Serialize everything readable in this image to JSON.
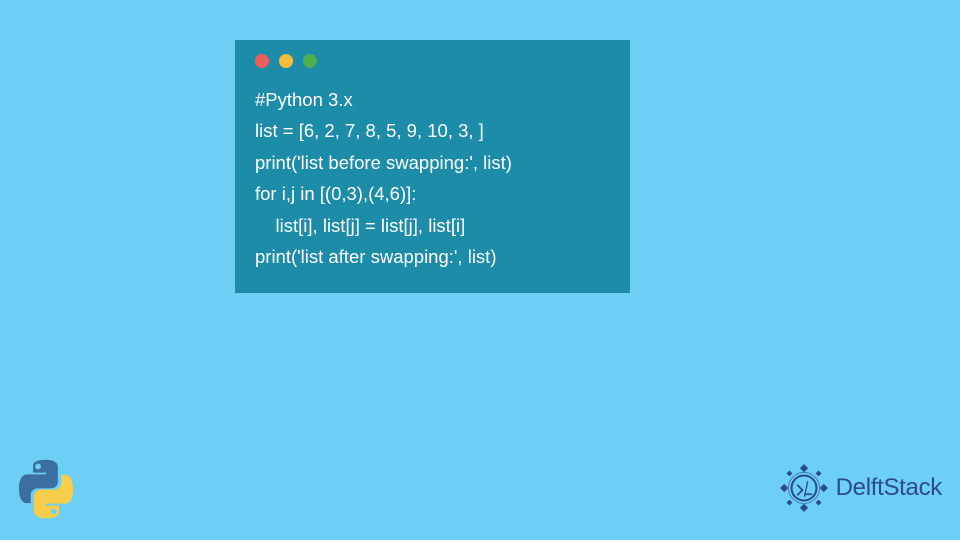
{
  "code": {
    "lines": [
      "#Python 3.x",
      "list = [6, 2, 7, 8, 5, 9, 10, 3, ]",
      "print('list before swapping:', list)",
      "for i,j in [(0,3),(4,6)]:",
      "    list[i], list[j] = list[j], list[i]",
      "print('list after swapping:', list)"
    ]
  },
  "brand": {
    "name": "DelftStack"
  },
  "chart_data": {
    "type": "table",
    "title": "Python code snippet: swap list elements",
    "language": "Python 3.x",
    "initial_list": [
      6,
      2,
      7,
      8,
      5,
      9,
      10,
      3
    ],
    "swap_pairs": [
      [
        0,
        3
      ],
      [
        4,
        6
      ]
    ],
    "operations": [
      "print list before swapping",
      "swap indices (0,3) and (4,6)",
      "print list after swapping"
    ]
  }
}
